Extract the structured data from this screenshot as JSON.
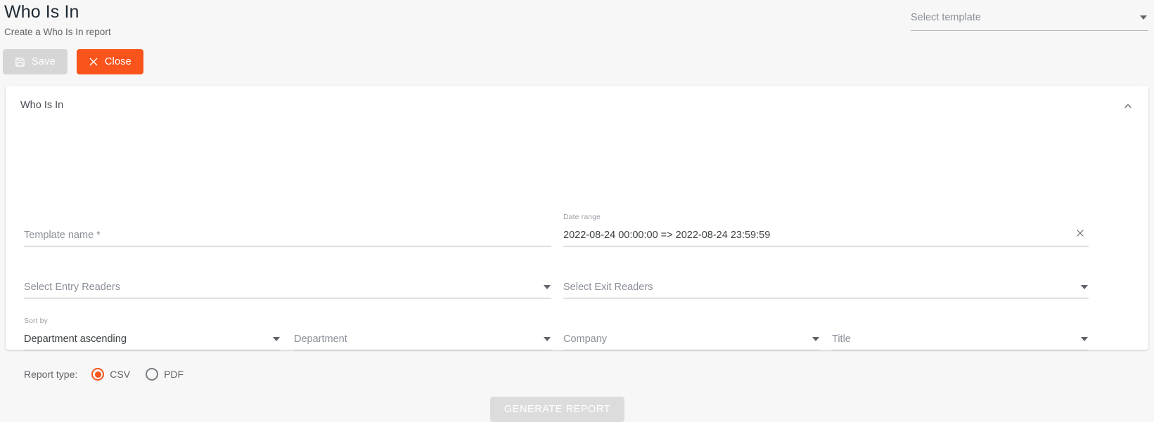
{
  "header": {
    "title": "Who Is In",
    "subtitle": "Create a Who Is In report",
    "template_select": {
      "placeholder": "Select template",
      "caret_icon": "chevron-down-icon"
    },
    "buttons": {
      "save": {
        "label": "Save",
        "icon": "save-disk-icon",
        "disabled": true,
        "bg": "#d6d6d6"
      },
      "close": {
        "label": "Close",
        "icon": "close-x-icon",
        "bg": "#f8541c"
      }
    }
  },
  "card": {
    "title": "Who Is In",
    "collapse_icon": "chevron-up-icon",
    "fields": {
      "template_name": {
        "label": "",
        "placeholder": "Template name *",
        "value": ""
      },
      "date_range": {
        "label": "Date range",
        "value": "2022-08-24 00:00:00 => 2022-08-24 23:59:59",
        "clear_icon": "close-x-icon"
      },
      "entry_readers": {
        "label": "",
        "placeholder": "Select Entry Readers",
        "caret_icon": "chevron-down-icon"
      },
      "exit_readers": {
        "label": "",
        "placeholder": "Select Exit Readers",
        "caret_icon": "chevron-down-icon"
      },
      "sort_by": {
        "label": "Sort by",
        "value": "Department ascending",
        "caret_icon": "chevron-down-icon"
      },
      "department": {
        "label": "",
        "placeholder": "Department",
        "caret_icon": "chevron-down-icon"
      },
      "company": {
        "label": "",
        "placeholder": "Company",
        "caret_icon": "chevron-down-icon"
      },
      "title_field": {
        "label": "",
        "placeholder": "Title",
        "caret_icon": "chevron-down-icon"
      }
    },
    "report_type": {
      "label": "Report type:",
      "options": [
        {
          "label": "CSV",
          "selected": true
        },
        {
          "label": "PDF",
          "selected": false
        }
      ],
      "accent_color": "#f8541c"
    },
    "generate_button": {
      "label": "GENERATE REPORT",
      "disabled": true,
      "bg": "#dcdcdc"
    }
  }
}
